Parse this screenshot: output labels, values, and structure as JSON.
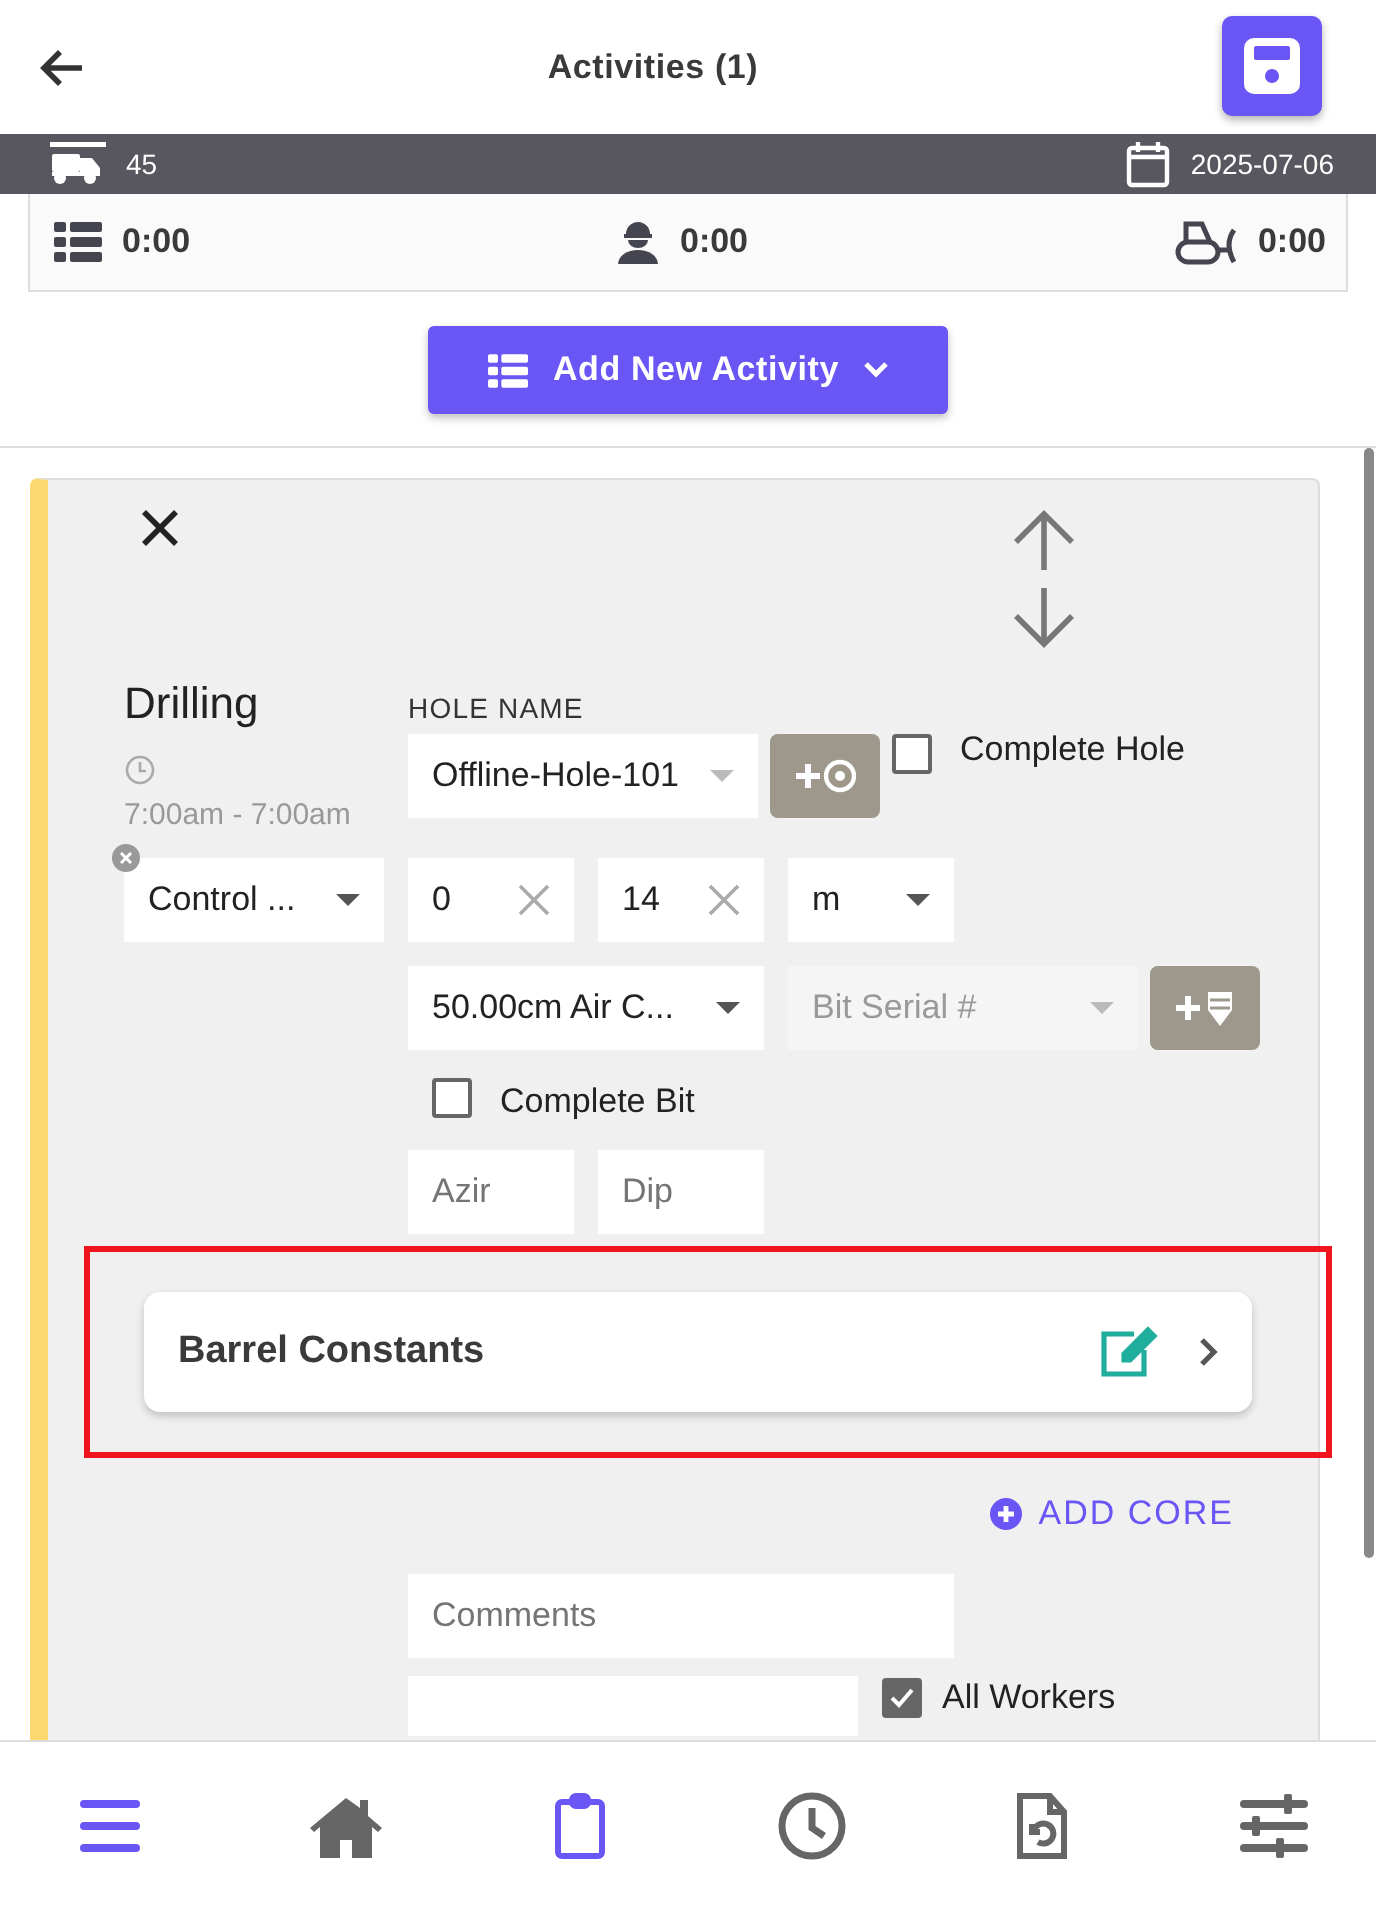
{
  "header": {
    "title": "Activities (1)"
  },
  "info_bar": {
    "rig": "45",
    "date": "2025-07-06"
  },
  "totals": [
    {
      "kind": "list",
      "value": "0:00"
    },
    {
      "kind": "worker",
      "value": "0:00"
    },
    {
      "kind": "dozer",
      "value": "0:00"
    }
  ],
  "add_button": {
    "label": "Add New Activity"
  },
  "activity": {
    "name": "Drilling",
    "time": "7:00am - 7:00am",
    "hole_label": "HOLE NAME",
    "hole": "Offline-Hole-101",
    "complete_hole": {
      "label": "Complete Hole",
      "checked": false
    },
    "type": "Control ...",
    "from": "0",
    "to": "14",
    "unit": "m",
    "bit": "50.00cm Air C...",
    "bit_serial": {
      "placeholder": "Bit Serial #",
      "disabled": true
    },
    "complete_bit": {
      "label": "Complete Bit",
      "checked": false
    },
    "azimuth": {
      "placeholder": "Azir"
    },
    "dip": {
      "placeholder": "Dip"
    },
    "barrel": {
      "title": "Barrel Constants",
      "highlighted": true
    },
    "add_core": "ADD CORE",
    "comments": {
      "placeholder": "Comments"
    },
    "all_workers": {
      "label": "All Workers",
      "checked": true
    }
  },
  "nav": [
    {
      "kind": "menu",
      "selected": true
    },
    {
      "kind": "home",
      "selected": false
    },
    {
      "kind": "clipboard",
      "selected": true
    },
    {
      "kind": "clock",
      "selected": false
    },
    {
      "kind": "report",
      "selected": false
    },
    {
      "kind": "sliders",
      "selected": false
    }
  ]
}
